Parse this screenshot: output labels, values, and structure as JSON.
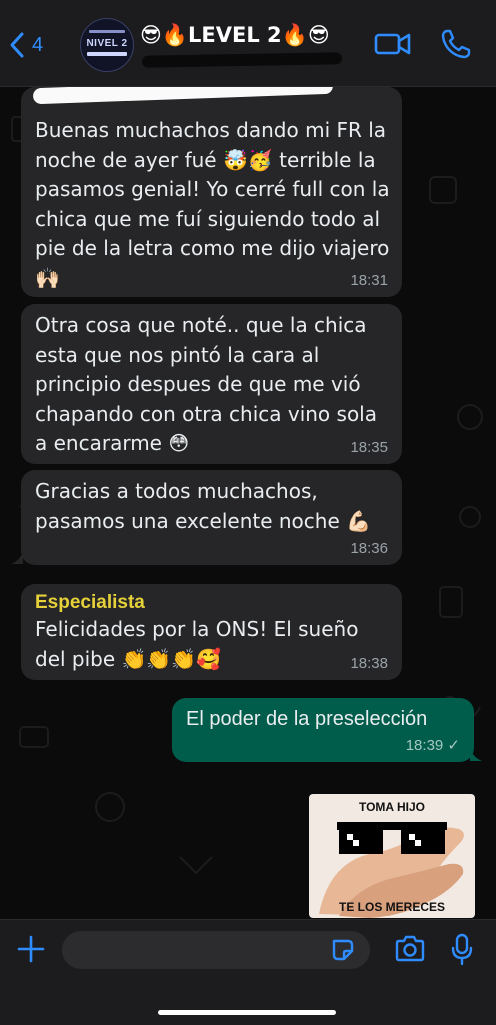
{
  "header": {
    "back_count": "4",
    "title": "😎🔥LEVEL 2🔥😎",
    "avatar_text": "NIVEL 2"
  },
  "messages": [
    {
      "direction": "incoming",
      "text": "Buenas muchachos dando mi FR la\nnoche de ayer fué 🤯🥳 terrible la\npasamos genial! Yo cerré full con la\nchica que me fuí siguiendo todo al\npie de la letra como me dijo viajero\n🙌🏻",
      "time": "18:31"
    },
    {
      "direction": "incoming",
      "text": "Otra cosa que noté.. que la chica\nesta que nos pintó la cara al\nprincipio despues de  que me vió\nchapando con otra chica vino sola\na encararme 😳",
      "time": "18:35"
    },
    {
      "direction": "incoming",
      "text": "Gracias a todos muchachos,\npasamos una excelente noche 💪🏻",
      "time": "18:36"
    },
    {
      "direction": "incoming",
      "sender": "Especialista",
      "text": "Felicidades por la ONS! El sueño\ndel pibe 👏👏👏🥰",
      "time": "18:38"
    },
    {
      "direction": "outgoing",
      "text": "El poder de la preselección",
      "time": "18:39 ✓"
    }
  ],
  "sticker": {
    "top_text": "TOMA HIJO",
    "bottom_text": "TE LOS MERECES"
  },
  "composer": {
    "value": "",
    "placeholder": ""
  },
  "colors": {
    "accent": "#2f8cff",
    "incoming_bubble": "#262628",
    "outgoing_bubble": "#005c4b",
    "sender_name": "#e6d13a"
  },
  "icons": [
    "chevron-left-icon",
    "video-call-icon",
    "phone-icon",
    "plus-icon",
    "sticker-icon",
    "camera-icon",
    "microphone-icon"
  ]
}
